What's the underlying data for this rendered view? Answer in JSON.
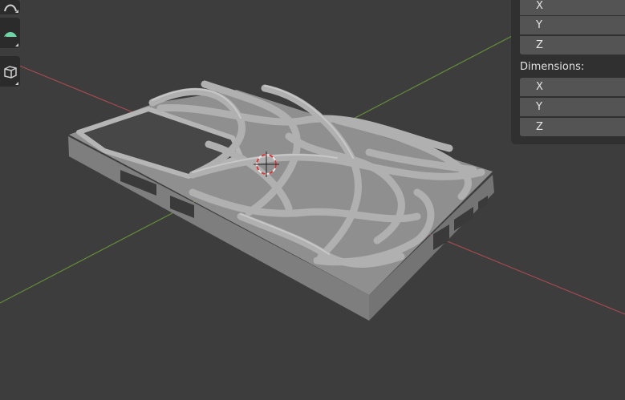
{
  "toolbar": {
    "tools": [
      {
        "name": "curve-tool",
        "icon": "curve-icon"
      },
      {
        "name": "measure-tool",
        "icon": "protractor-icon"
      },
      {
        "name": "add-cube-tool",
        "icon": "cube-icon"
      }
    ]
  },
  "npanel": {
    "scale_axes": [
      "X",
      "Y",
      "Z"
    ],
    "dimensions_label": "Dimensions:",
    "dimensions_axes": [
      "X",
      "Y",
      "Z"
    ]
  },
  "colors": {
    "viewport_bg": "#3d3d3d",
    "x_axis": "#b44a52",
    "y_axis": "#6a9a3a",
    "mesh": "#9a9a9a",
    "accent_tool": "#6fd3a5"
  }
}
